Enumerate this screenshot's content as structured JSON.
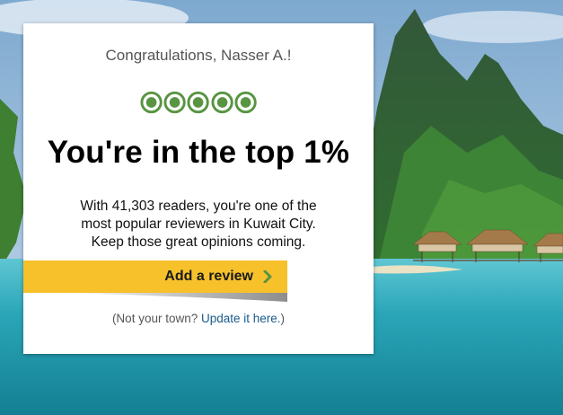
{
  "colors": {
    "accent": "#589442",
    "cta_background": "#f6c12a",
    "link": "#1a5a8a"
  },
  "background": {
    "icon": "tropical-lagoon-overwater-bungalows-photo"
  },
  "card": {
    "greeting": "Congratulations, Nasser A.!",
    "rating": {
      "filled": 5,
      "max": 5,
      "icon": "rating-bubble-icon"
    },
    "headline": "You're in the top 1%",
    "body_lines": [
      "With 41,303 readers, you're one of the",
      "most popular reviewers in Kuwait City.",
      "Keep those great opinions coming."
    ],
    "cta": {
      "label": "Add a review",
      "icon": "chevron-right-icon"
    },
    "footer": {
      "prefix": "(Not your town? ",
      "link": "Update it here.",
      "suffix": ")"
    }
  }
}
